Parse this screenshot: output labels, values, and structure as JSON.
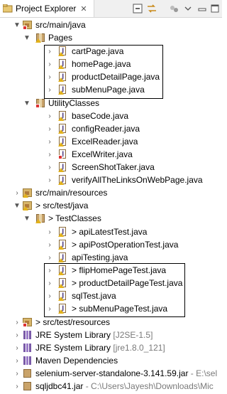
{
  "tab": {
    "title": "Project Explorer",
    "close": "✕"
  },
  "toolbar": {
    "collapse_icon": "collapse-all-icon",
    "link_icon": "link-with-editor-icon",
    "filter_icon": "filter-icon",
    "menu_icon": "view-menu-icon",
    "minimize_icon": "minimize-icon",
    "maximize_icon": "maximize-icon"
  },
  "tree": {
    "src_main_java": "src/main/java",
    "pages": "Pages",
    "pages_files": [
      "cartPage.java",
      "homePage.java",
      "productDetailPage.java",
      "subMenuPage.java"
    ],
    "utility": "UtilityClasses",
    "utility_files": [
      "baseCode.java",
      "configReader.java",
      "ExcelReader.java",
      "ExcelWriter.java",
      "ScreenShotTaker.java",
      "verifyAllTheLinksOnWebPage.java"
    ],
    "src_main_resources": "src/main/resources",
    "src_test_java": "src/test/java",
    "test_prefix": ">",
    "testclasses": "TestClasses",
    "test_files_top": [
      "apiLatestTest.java",
      "apiPostOperationTest.java",
      "apiTesting.java"
    ],
    "test_files_boxed": [
      "flipHomePageTest.java",
      "productDetailPageTest.java",
      "sqlTest.java",
      "subMenuPageTest.java"
    ],
    "src_test_resources": "src/test/resources",
    "jre1": "JRE System Library",
    "jre1_detail": "[J2SE-1.5]",
    "jre2": "JRE System Library",
    "jre2_detail": "[jre1.8.0_121]",
    "maven": "Maven Dependencies",
    "jar1": "selenium-server-standalone-3.141.59.jar",
    "jar1_path": "- E:\\sel",
    "jar2": "sqljdbc41.jar",
    "jar2_path": "- C:\\Users\\Jayesh\\Downloads\\Mic"
  }
}
